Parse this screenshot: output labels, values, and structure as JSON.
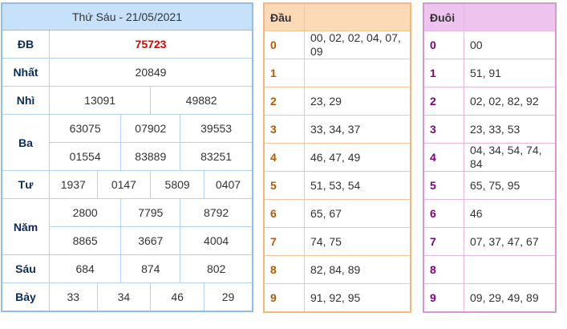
{
  "results": {
    "title": "Thứ Sáu - 21/05/2021",
    "rows": [
      {
        "label": "ĐB",
        "values": [
          "75723"
        ]
      },
      {
        "label": "Nhất",
        "values": [
          "20849"
        ]
      },
      {
        "label": "Nhì",
        "values": [
          "13091",
          "49882"
        ]
      },
      {
        "label": "Ba",
        "values": [
          "63075",
          "07902",
          "39553",
          "01554",
          "83889",
          "83251"
        ]
      },
      {
        "label": "Tư",
        "values": [
          "1937",
          "0147",
          "5809",
          "0407"
        ]
      },
      {
        "label": "Năm",
        "values": [
          "2800",
          "7795",
          "8792",
          "8865",
          "3667",
          "4004"
        ]
      },
      {
        "label": "Sáu",
        "values": [
          "684",
          "874",
          "802"
        ]
      },
      {
        "label": "Bảy",
        "values": [
          "33",
          "34",
          "46",
          "29"
        ]
      }
    ]
  },
  "head": {
    "title": "Đầu",
    "rows": [
      {
        "key": "0",
        "value": "00, 02, 02, 04, 07, 09"
      },
      {
        "key": "1",
        "value": ""
      },
      {
        "key": "2",
        "value": "23, 29"
      },
      {
        "key": "3",
        "value": "33, 34, 37"
      },
      {
        "key": "4",
        "value": "46, 47, 49"
      },
      {
        "key": "5",
        "value": "51, 53, 54"
      },
      {
        "key": "6",
        "value": "65, 67"
      },
      {
        "key": "7",
        "value": "74, 75"
      },
      {
        "key": "8",
        "value": "82, 84, 89"
      },
      {
        "key": "9",
        "value": "91, 92, 95"
      }
    ]
  },
  "tail": {
    "title": "Đuôi",
    "rows": [
      {
        "key": "0",
        "value": "00"
      },
      {
        "key": "1",
        "value": "51, 91"
      },
      {
        "key": "2",
        "value": "02, 02, 82, 92"
      },
      {
        "key": "3",
        "value": "23, 33, 53"
      },
      {
        "key": "4",
        "value": "04, 34, 54, 74, 84"
      },
      {
        "key": "5",
        "value": "65, 75, 95"
      },
      {
        "key": "6",
        "value": "46"
      },
      {
        "key": "7",
        "value": "07, 37, 47, 67"
      },
      {
        "key": "8",
        "value": ""
      },
      {
        "key": "9",
        "value": "09, 29, 49, 89"
      }
    ]
  },
  "colors": {
    "results_border": "#8fbfe6",
    "results_header_bg": "#c7e1fa",
    "special_prize": "#e00000",
    "head_border": "#f7b67a",
    "head_header_bg": "#fcd9b7",
    "head_key": "#b35a00",
    "tail_border": "#d398d3",
    "tail_header_bg": "#eec4ee",
    "tail_key": "#800080"
  }
}
